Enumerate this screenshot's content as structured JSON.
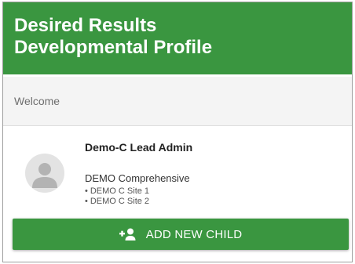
{
  "header": {
    "title": "Desired Results\nDevelopmental Profile"
  },
  "welcome": {
    "label": "Welcome"
  },
  "user": {
    "name": "Demo-C Lead Admin",
    "organization": "DEMO Comprehensive",
    "sites": [
      "DEMO C Site 1",
      "DEMO C Site 2"
    ]
  },
  "actions": {
    "add_child_label": "ADD NEW CHILD",
    "add_child_icon": "person-add-icon"
  },
  "colors": {
    "brand_green": "#3a9640",
    "welcome_bg": "#f4f4f4"
  }
}
